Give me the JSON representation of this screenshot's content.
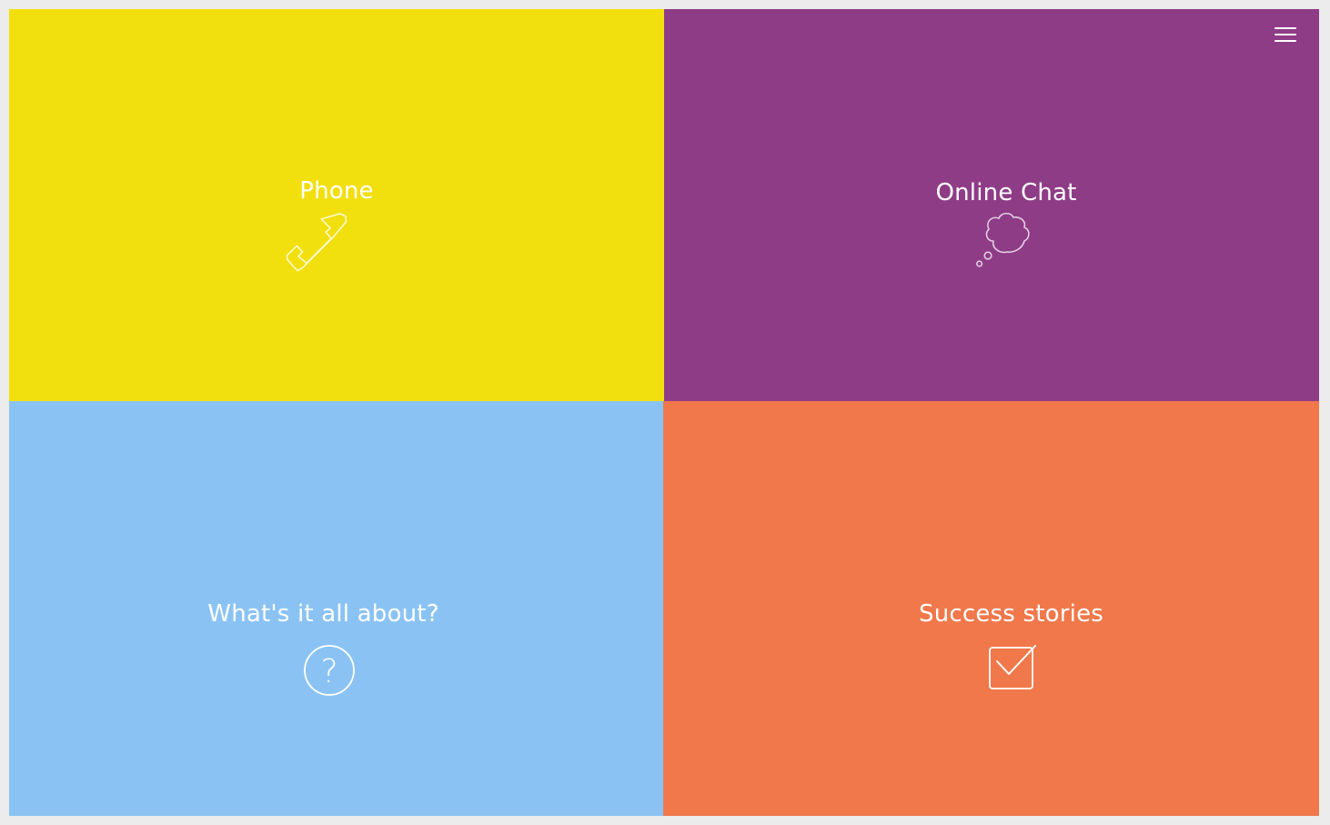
{
  "theme": {
    "page_background": "#ececec",
    "text_color": "#ffffff"
  },
  "header": {
    "menu_icon": "hamburger-menu-icon"
  },
  "tiles": [
    {
      "id": "phone",
      "label": "Phone",
      "icon": "phone-handset-icon",
      "color": "#f2df0e"
    },
    {
      "id": "chat",
      "label": "Online Chat",
      "icon": "thought-bubble-icon",
      "color": "#8f3c87"
    },
    {
      "id": "about",
      "label": "What's it all about?",
      "icon": "question-circle-icon",
      "color": "#8ac3f3"
    },
    {
      "id": "stories",
      "label": "Success stories",
      "icon": "checkbox-icon",
      "color": "#f0784b"
    }
  ]
}
